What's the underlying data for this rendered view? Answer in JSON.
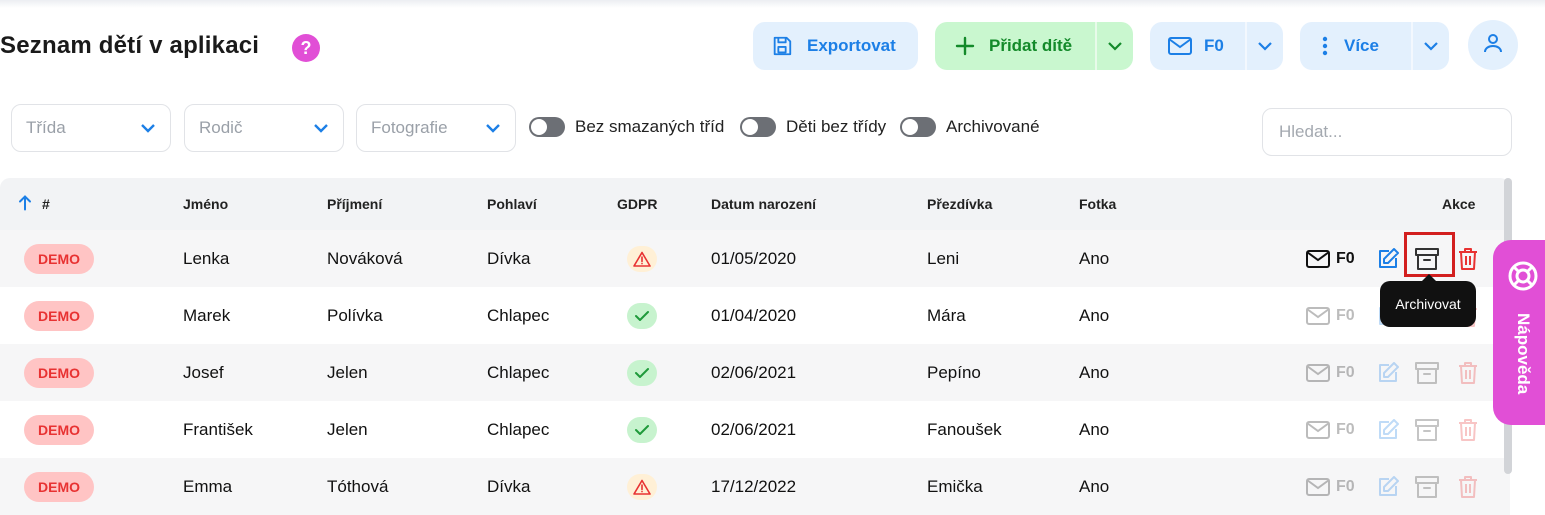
{
  "header": {
    "title": "Seznam dětí v aplikaci",
    "help_glyph": "?"
  },
  "toolbar": {
    "export_label": "Exportovat",
    "add_child_label": "Přidat dítě",
    "mail_label": "F0",
    "more_label": "Více"
  },
  "filters": {
    "class_select": "Třída",
    "parent_select": "Rodič",
    "photo_select": "Fotografie",
    "toggles": [
      {
        "label": "Bez smazaných tříd",
        "on": false
      },
      {
        "label": "Děti bez třídy",
        "on": false
      },
      {
        "label": "Archivované",
        "on": false
      }
    ],
    "search_placeholder": "Hledat..."
  },
  "table": {
    "columns": [
      "#",
      "Jméno",
      "Příjmení",
      "Pohlaví",
      "GDPR",
      "Datum narození",
      "Přezdívka",
      "Fotka",
      "Akce"
    ],
    "rows": [
      {
        "badge": "DEMO",
        "first": "Lenka",
        "last": "Nováková",
        "gender": "Dívka",
        "gdpr": "warning",
        "birth": "01/05/2020",
        "nick": "Leni",
        "photo": "Ano",
        "mail": "F0"
      },
      {
        "badge": "DEMO",
        "first": "Marek",
        "last": "Polívka",
        "gender": "Chlapec",
        "gdpr": "ok",
        "birth": "01/04/2020",
        "nick": "Mára",
        "photo": "Ano",
        "mail": "F0"
      },
      {
        "badge": "DEMO",
        "first": "Josef",
        "last": "Jelen",
        "gender": "Chlapec",
        "gdpr": "ok",
        "birth": "02/06/2021",
        "nick": "Pepíno",
        "photo": "Ano",
        "mail": "F0"
      },
      {
        "badge": "DEMO",
        "first": "František",
        "last": "Jelen",
        "gender": "Chlapec",
        "gdpr": "ok",
        "birth": "02/06/2021",
        "nick": "Fanoušek",
        "photo": "Ano",
        "mail": "F0"
      },
      {
        "badge": "DEMO",
        "first": "Emma",
        "last": "Tóthová",
        "gender": "Dívka",
        "gdpr": "warning",
        "birth": "17/12/2022",
        "nick": "Emička",
        "photo": "Ano",
        "mail": "F0"
      }
    ]
  },
  "tooltip": {
    "text": "Archivovat"
  },
  "help_tab": {
    "label": "Nápověda"
  },
  "colors": {
    "accent": "#1c7fe6",
    "add": "#138a2a",
    "danger": "#e83232",
    "help": "#e14fd6"
  }
}
